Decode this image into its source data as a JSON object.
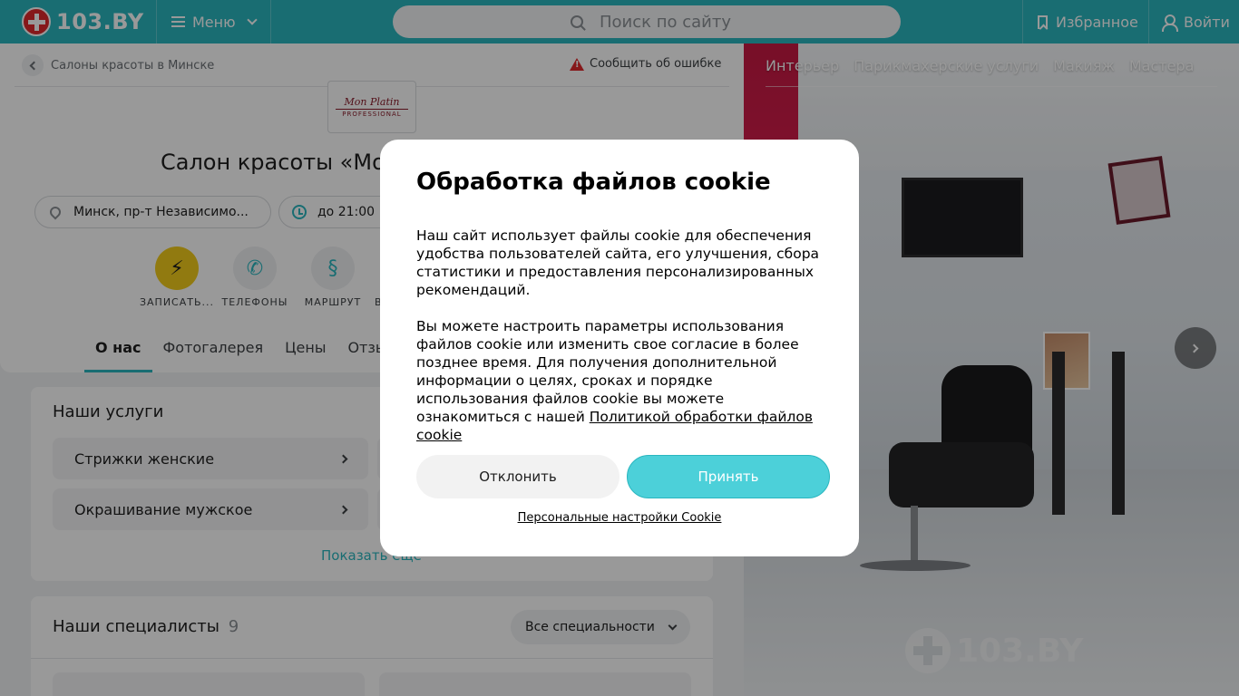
{
  "header": {
    "logo_text": "103.BY",
    "menu_label": "Меню",
    "search_placeholder": "Поиск по сайту",
    "favorites_label": "Избранное",
    "login_label": "Войти"
  },
  "breadcrumb": {
    "back_label": "Салоны красоты в Минске",
    "report_label": "Сообщить об ошибке"
  },
  "brand": {
    "script": "Mon Platin",
    "sub": "PROFESSIONAL"
  },
  "salon": {
    "title": "Салон красоты «Mon Platin»",
    "address": "Минск, пр-т Независимо...",
    "hours": "до 21:00"
  },
  "actions": [
    {
      "label": "ЗАПИСАТЬ...",
      "icon": "lightning-icon"
    },
    {
      "label": "ТЕЛЕФОНЫ",
      "icon": "phone-icon"
    },
    {
      "label": "МАРШРУТ",
      "icon": "route-icon"
    },
    {
      "label": "В"
    }
  ],
  "tabs": [
    "О нас",
    "Фотогалерея",
    "Цены",
    "Отзы"
  ],
  "services": {
    "title": "Наши услуги",
    "items": [
      "Стрижки женские",
      "Окрашивание мужское"
    ],
    "more_label": "Показать еще"
  },
  "specialists": {
    "title": "Наши специалисты",
    "count": "9",
    "filter_label": "Все специальности"
  },
  "photo": {
    "tabs": [
      "Интерьер",
      "Парикмахерские услуги",
      "Макияж",
      "Мастера"
    ],
    "watermark": "103.BY"
  },
  "cookie": {
    "title": "Обработка файлов cookie",
    "para1": "Наш сайт использует файлы cookie для обеспечения удобства пользователей сайта, его улучшения, сбора статистики и предоставления персонализированных рекомендаций.",
    "para2": "Вы можете настроить параметры использования файлов cookie или изменить свое согласие в более позднее время. Для получения дополнительной информации о целях, сроках и порядке использования файлов cookie вы можете ознакомиться с нашей",
    "policy_link": "Политикой обработки файлов cookie",
    "decline_label": "Отклонить",
    "accept_label": "Принять",
    "settings_label": "Персональные настройки Cookie"
  },
  "colors": {
    "brand_teal": "#2ab6bf",
    "accept_button": "#4cd0d9",
    "logo_red": "#e0282c",
    "book_button_yellow": "#f2cc1b"
  }
}
